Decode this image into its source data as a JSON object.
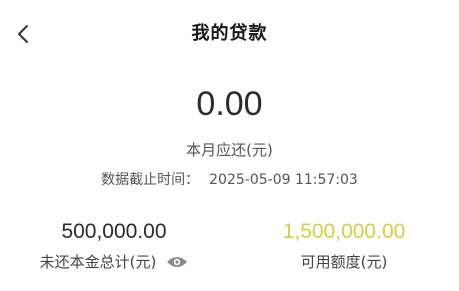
{
  "header": {
    "title": "我的贷款",
    "back_icon": "chevron-left-icon"
  },
  "repayment": {
    "amount": "0.00",
    "label": "本月应还(元)",
    "cutoff_label": "数据截止时间：",
    "cutoff_time": "2025-05-09 11:57:03"
  },
  "stats": {
    "outstanding_value": "500,000.00",
    "outstanding_label": "未还本金总计(元)",
    "visibility_icon": "eye-icon",
    "available_value": "1,500,000.00",
    "available_label": "可用额度(元)"
  },
  "colors": {
    "available_accent": "#d4d13a",
    "text_primary": "#2b2b2b",
    "text_secondary": "#555555"
  }
}
